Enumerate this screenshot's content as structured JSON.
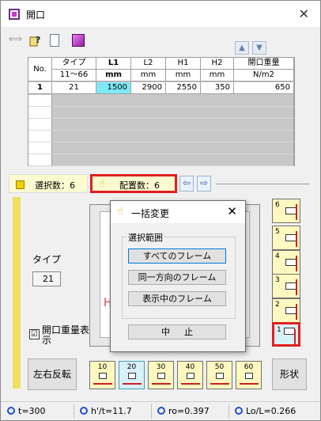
{
  "window": {
    "title": "開口"
  },
  "table": {
    "headers_top": [
      "No.",
      "タイプ",
      "L1",
      "L2",
      "H1",
      "H2",
      "開口重量"
    ],
    "headers_sub": [
      "",
      "11〜66",
      "mm",
      "mm",
      "mm",
      "mm",
      "N/m2"
    ],
    "rows": [
      [
        "1",
        "21",
        "1500",
        "2900",
        "2550",
        "350",
        "650"
      ]
    ]
  },
  "midbar": {
    "selection_count": "選択数：6",
    "placement_count": "配置数：6"
  },
  "left_panel": {
    "type_label": "タイプ",
    "type_value": "21",
    "weight_checkbox_label": "開口重量表示",
    "weight_checked": "☑",
    "flip_button": "左右反転"
  },
  "right_buttons": [
    "6",
    "5",
    "4",
    "3",
    "2",
    "1"
  ],
  "bottom_buttons": [
    "10",
    "20",
    "30",
    "40",
    "50",
    "60"
  ],
  "shape_button": "形状",
  "canvas_letter": "H",
  "status": {
    "t": "t=300",
    "ht": "h'/t=11.7",
    "ro": "ro=0.397",
    "lol": "Lo/L=0.266"
  },
  "dialog": {
    "title": "一括変更",
    "group_label": "選択範囲",
    "btn_all": "すべてのフレーム",
    "btn_same_dir": "同一方向のフレーム",
    "btn_visible": "表示中のフレーム",
    "btn_cancel": "中止"
  }
}
